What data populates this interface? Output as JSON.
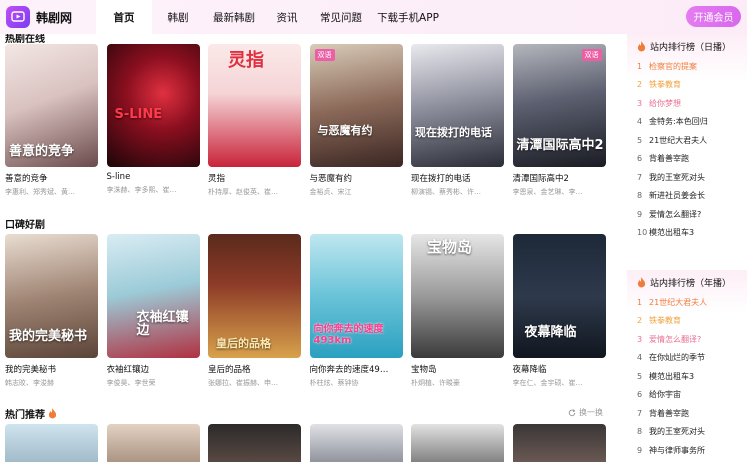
{
  "header": {
    "logo_text": "韩剧网",
    "nav": [
      {
        "label": "首页",
        "active": true
      },
      {
        "label": "韩剧",
        "active": false
      },
      {
        "label": "最新韩剧",
        "active": false
      },
      {
        "label": "资讯",
        "active": false
      },
      {
        "label": "常见问题",
        "active": false
      },
      {
        "label": "下载手机APP",
        "active": false
      }
    ],
    "vip_label": "开通会员"
  },
  "sections": {
    "hot_playing": {
      "title": "热剧在线",
      "items": [
        {
          "title": "善意的竞争",
          "sub": "李惠利、郑秀斌、黄…",
          "poster_text": "善意的竞争",
          "badge": ""
        },
        {
          "title": "S-line",
          "sub": "李洙赫、李多熙、崔…",
          "poster_text": "S-LINE",
          "badge": ""
        },
        {
          "title": "灵指",
          "sub": "朴持厚、赵俊英、崔…",
          "poster_text": "灵指",
          "badge": ""
        },
        {
          "title": "与恶魔有约",
          "sub": "金裕贞、宋江",
          "poster_text": "与恶魔有约",
          "badge": "双语"
        },
        {
          "title": "现在拨打的电话",
          "sub": "柳演锡、蔡秀彬、许…",
          "poster_text": "现在拨打的电话",
          "badge": ""
        },
        {
          "title": "清潭国际高中2",
          "sub": "李恩泉、金艺琳、李…",
          "poster_text": "清潭国际高中2",
          "badge": "双语"
        }
      ]
    },
    "praise": {
      "title": "口碑好剧",
      "items": [
        {
          "title": "我的完美秘书",
          "sub": "韩志旼、李浚赫",
          "poster_text": "我的完美秘书",
          "badge": ""
        },
        {
          "title": "衣袖红镶边",
          "sub": "李俊昊、李世荣",
          "poster_text": "衣袖红镶边",
          "badge": ""
        },
        {
          "title": "皇后的品格",
          "sub": "张娜拉、崔振赫、申…",
          "poster_text": "皇后的品格",
          "badge": ""
        },
        {
          "title": "向你奔去的速度49…",
          "sub": "朴柱炫、蔡钟协",
          "poster_text": "向你奔去的速度493km",
          "badge": ""
        },
        {
          "title": "宝物岛",
          "sub": "朴炯植、许畯豪",
          "poster_text": "宝物岛",
          "badge": ""
        },
        {
          "title": "夜幕降临",
          "sub": "李在仁、金宇硕、崔…",
          "poster_text": "夜幕降临",
          "badge": ""
        }
      ]
    },
    "recommend": {
      "title": "热门推荐",
      "refresh_label": "换一换"
    }
  },
  "sidebar": {
    "daily": {
      "title": "站内排行榜（日播）",
      "items": [
        {
          "num": "1",
          "name": "检察官的提案"
        },
        {
          "num": "2",
          "name": "铁拳教育"
        },
        {
          "num": "3",
          "name": "给你梦想"
        },
        {
          "num": "4",
          "name": "金特务:本色回归"
        },
        {
          "num": "5",
          "name": "21世纪大君夫人"
        },
        {
          "num": "6",
          "name": "背着善宰跑"
        },
        {
          "num": "7",
          "name": "我的王室死对头"
        },
        {
          "num": "8",
          "name": "新进社员姜会长"
        },
        {
          "num": "9",
          "name": "爱情怎么翻译?"
        },
        {
          "num": "10",
          "name": "模范出租车3"
        }
      ]
    },
    "yearly": {
      "title": "站内排行榜（年播）",
      "items": [
        {
          "num": "1",
          "name": "21世纪大君夫人"
        },
        {
          "num": "2",
          "name": "铁拳教育"
        },
        {
          "num": "3",
          "name": "爱情怎么翻译?"
        },
        {
          "num": "4",
          "name": "在你灿烂的季节"
        },
        {
          "num": "5",
          "name": "模范出租车3"
        },
        {
          "num": "6",
          "name": "给你宇宙"
        },
        {
          "num": "7",
          "name": "背着善宰跑"
        },
        {
          "num": "8",
          "name": "我的王室死对头"
        },
        {
          "num": "9",
          "name": "神与律师事务所"
        }
      ]
    }
  },
  "colors": {
    "accent": "#d868ee",
    "rank_hot": "#f07c3b",
    "rank_warm": "#f0a23b",
    "rank_pink": "#e86f92"
  }
}
